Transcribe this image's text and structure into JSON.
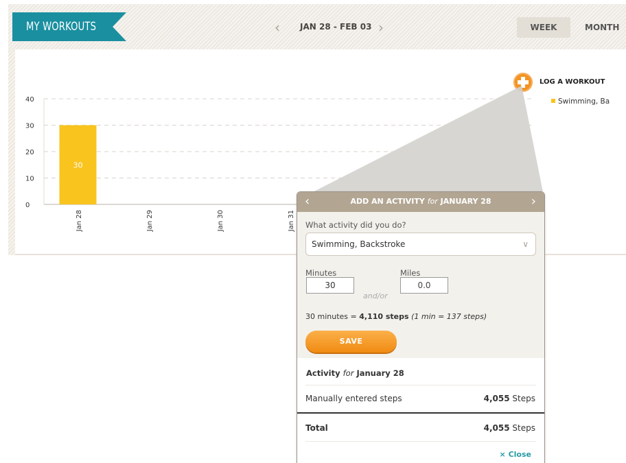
{
  "header": {
    "title": "MY WORKOUTS",
    "date_range": "JAN 28 - FEB 03",
    "prev_glyph": "‹",
    "next_glyph": "›",
    "tabs": [
      {
        "label": "WEEK",
        "active": true
      },
      {
        "label": "MONTH",
        "active": false
      }
    ]
  },
  "log_workout": {
    "label": "LOG A WORKOUT",
    "icon": "plus-circle-icon"
  },
  "legend": {
    "label": "Swimming, Ba",
    "color": "#f9c41e"
  },
  "chart_data": {
    "type": "bar",
    "categories": [
      "Jan 28",
      "Jan 29",
      "Jan 30",
      "Jan 31"
    ],
    "series": [
      {
        "name": "Swimming, Ba",
        "values": [
          30,
          0,
          0,
          0
        ]
      }
    ],
    "data_labels": [
      "30",
      "",
      "",
      ""
    ],
    "y_ticks": [
      0,
      10,
      20,
      30,
      40
    ],
    "ylim": [
      0,
      40
    ],
    "grid": true,
    "bar_color": "#f9c41e"
  },
  "popup": {
    "title_prefix": "ADD AN ACTIVITY",
    "title_for": "for",
    "title_date": "JANUARY 28",
    "prev_glyph": "‹",
    "next_glyph": "›",
    "question": "What activity did you do?",
    "activity_value": "Swimming, Backstroke",
    "chevron": "∨",
    "minutes_label": "Minutes",
    "minutes_value": "30",
    "miles_label": "Miles",
    "miles_value": "0.0",
    "and_or": "and/or",
    "calc_minutes": "30",
    "calc_minutes_word": "minutes =",
    "calc_steps": "4,110 steps",
    "calc_rate": "(1 min = 137 steps)",
    "save_label": "SAVE",
    "activity_heading_prefix": "Activity",
    "activity_heading_for": "for",
    "activity_heading_date": "January 28",
    "row_label": "Manually entered steps",
    "row_value_num": "4,055",
    "row_value_unit": "Steps",
    "total_label": "Total",
    "total_value_num": "4,055",
    "total_value_unit": "Steps",
    "close_label": "× Close"
  },
  "colors": {
    "accent_teal": "#1a8fa0",
    "orange": "#f39323",
    "bar": "#f9c41e",
    "popup_head": "#b2a693"
  }
}
